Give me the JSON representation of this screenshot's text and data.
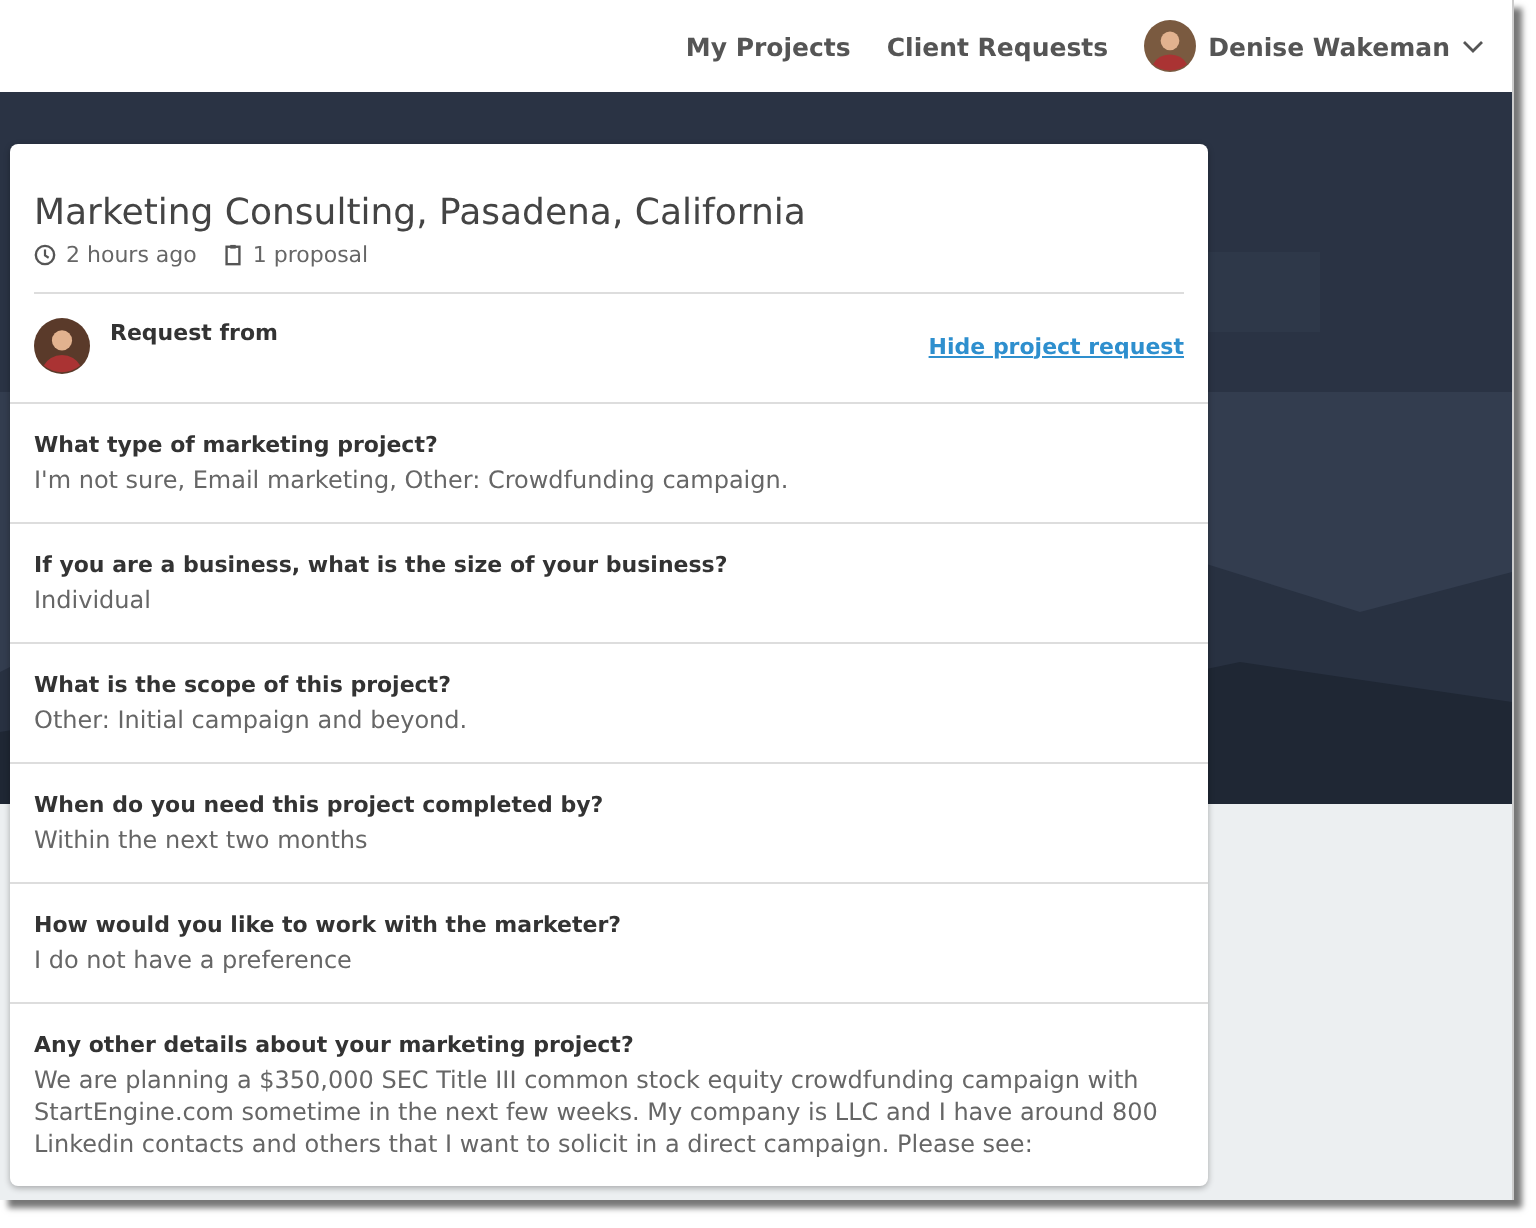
{
  "nav": {
    "links": [
      {
        "label": "My Projects"
      },
      {
        "label": "Client Requests"
      }
    ],
    "user": {
      "name": "Denise Wakeman"
    }
  },
  "request": {
    "title": "Marketing Consulting, Pasadena, California",
    "posted": "2 hours ago",
    "proposals": "1 proposal",
    "from_label": "Request from",
    "hide_link": "Hide project request",
    "questions": [
      {
        "question": "What type of marketing project?",
        "answer": "I'm not sure, Email marketing, Other: Crowdfunding campaign."
      },
      {
        "question": "If you are a business, what is the size of your business?",
        "answer": "Individual"
      },
      {
        "question": "What is the scope of this project?",
        "answer": "Other: Initial campaign and beyond."
      },
      {
        "question": "When do you need this project completed by?",
        "answer": "Within the next two months"
      },
      {
        "question": "How would you like to work with the marketer?",
        "answer": "I do not have a preference"
      },
      {
        "question": "Any other details about your marketing project?",
        "answer": "We are planning a $350,000 SEC Title III common stock equity crowdfunding campaign with StartEngine.com sometime in the next few weeks. My company is LLC and I have around 800 Linkedin contacts and others that I want to solicit in a direct campaign. Please see:"
      }
    ]
  }
}
